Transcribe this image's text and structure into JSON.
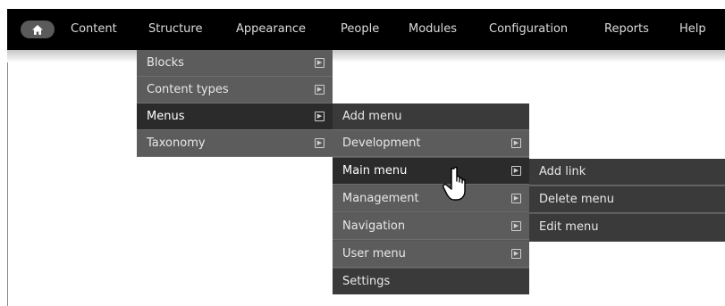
{
  "toolbar": {
    "home_icon": "home-icon",
    "items": [
      {
        "label": "Content"
      },
      {
        "label": "Structure"
      },
      {
        "label": "Appearance"
      },
      {
        "label": "People"
      },
      {
        "label": "Modules"
      },
      {
        "label": "Configuration"
      },
      {
        "label": "Reports"
      },
      {
        "label": "Help"
      }
    ]
  },
  "structure_menu": {
    "items": [
      {
        "label": "Blocks"
      },
      {
        "label": "Content types"
      },
      {
        "label": "Menus"
      },
      {
        "label": "Taxonomy"
      }
    ]
  },
  "menus_submenu": {
    "items": [
      {
        "label": "Add menu"
      },
      {
        "label": "Development"
      },
      {
        "label": "Main menu"
      },
      {
        "label": "Management"
      },
      {
        "label": "Navigation"
      },
      {
        "label": "User menu"
      },
      {
        "label": "Settings"
      }
    ]
  },
  "main_menu_submenu": {
    "items": [
      {
        "label": "Add link"
      },
      {
        "label": "Delete menu"
      },
      {
        "label": "Edit menu"
      }
    ]
  },
  "colors": {
    "toolbar_bg": "#000000",
    "menu_bg": "#5c5c5c",
    "menu_active_bg": "#2b2b2b",
    "menu_text": "#e8e8e8"
  }
}
